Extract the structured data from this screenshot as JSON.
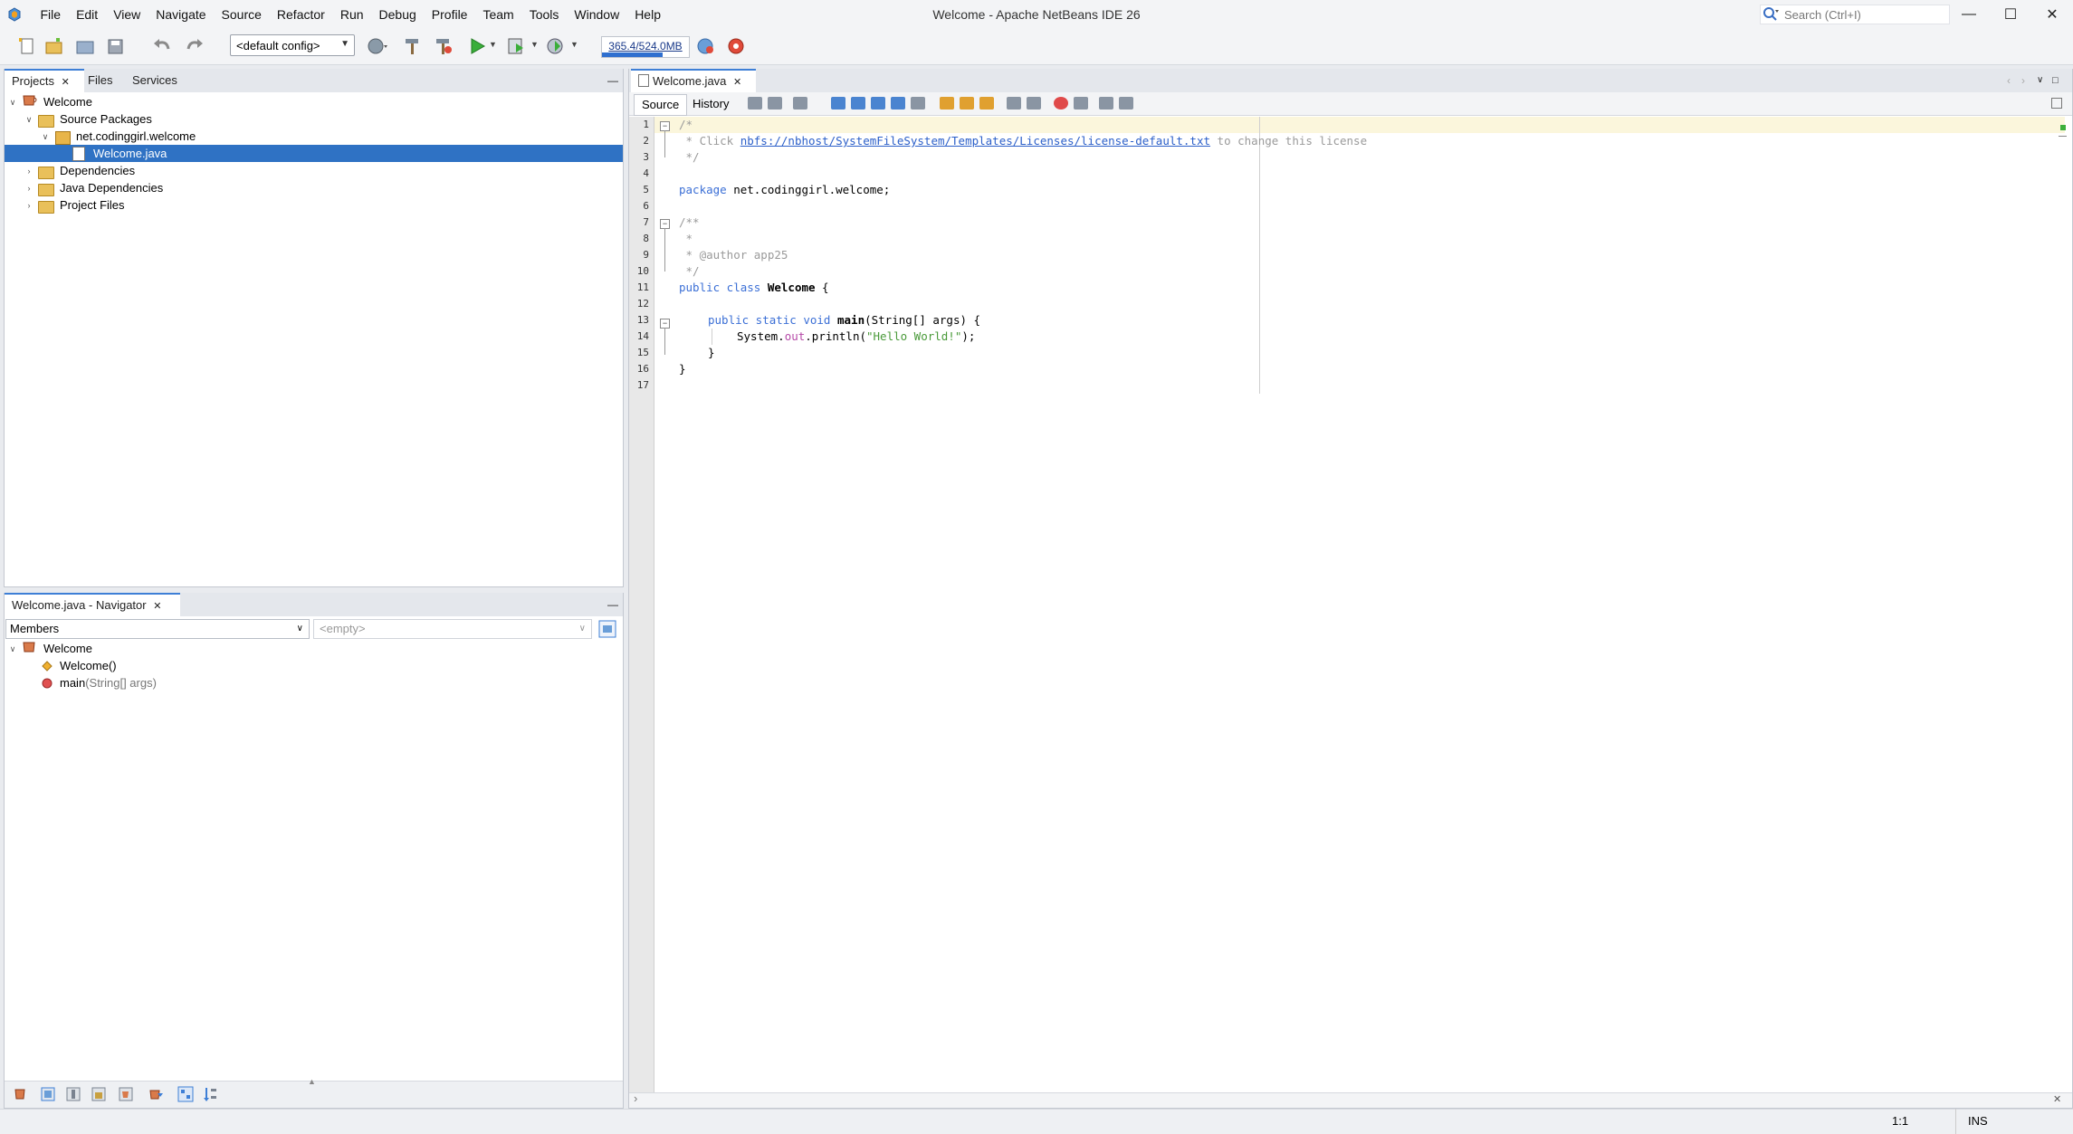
{
  "window": {
    "title": "Welcome - Apache NetBeans IDE 26"
  },
  "menu": [
    "File",
    "Edit",
    "View",
    "Navigate",
    "Source",
    "Refactor",
    "Run",
    "Debug",
    "Profile",
    "Team",
    "Tools",
    "Window",
    "Help"
  ],
  "search": {
    "placeholder": "Search (Ctrl+I)"
  },
  "toolbar": {
    "config": "<default config>",
    "memory": "365.4/524.0MB",
    "memory_fraction": 0.7
  },
  "projects_panel": {
    "tabs": [
      "Projects",
      "Files",
      "Services"
    ],
    "tree": [
      {
        "label": "Welcome"
      },
      {
        "label": "Source Packages"
      },
      {
        "label": "net.codinggirl.welcome"
      },
      {
        "label": "Welcome.java"
      },
      {
        "label": "Dependencies"
      },
      {
        "label": "Java Dependencies"
      },
      {
        "label": "Project Files"
      }
    ]
  },
  "navigator": {
    "tab": "Welcome.java - Navigator",
    "filter": "Members",
    "context": "<empty>",
    "items": [
      "Welcome",
      "Welcome()",
      "main(String[] args)"
    ],
    "main_name": "main",
    "main_params": "(String[] args)"
  },
  "editor": {
    "tab": "Welcome.java",
    "subtabs": [
      "Source",
      "History"
    ],
    "line_numbers": [
      "1",
      "2",
      "3",
      "4",
      "5",
      "6",
      "7",
      "8",
      "9",
      "10",
      "11",
      "12",
      "13",
      "14",
      "15",
      "16",
      "17"
    ],
    "code": {
      "l1": "/*",
      "l2_a": " * Click ",
      "l2_link": "nbfs://nbhost/SystemFileSystem/Templates/Licenses/license-default.txt",
      "l2_b": " to change this license",
      "l3": " */",
      "l5_kw": "package",
      "l5_rest": " net.codinggirl.welcome;",
      "l7": "/**",
      "l8": " *",
      "l9": " * @author app25",
      "l10": " */",
      "l11_kw": "public class",
      "l11_name": "Welcome",
      "l11_rest": " {",
      "l13_kw": "public static void",
      "l13_name": "main",
      "l13_rest": "(String[] args) {",
      "l14_a": "System.",
      "l14_field": "out",
      "l14_b": ".println(",
      "l14_str": "\"Hello World!\"",
      "l14_c": ");",
      "l15": "}",
      "l16": "}"
    }
  },
  "status": {
    "position": "1:1",
    "mode": "INS"
  }
}
